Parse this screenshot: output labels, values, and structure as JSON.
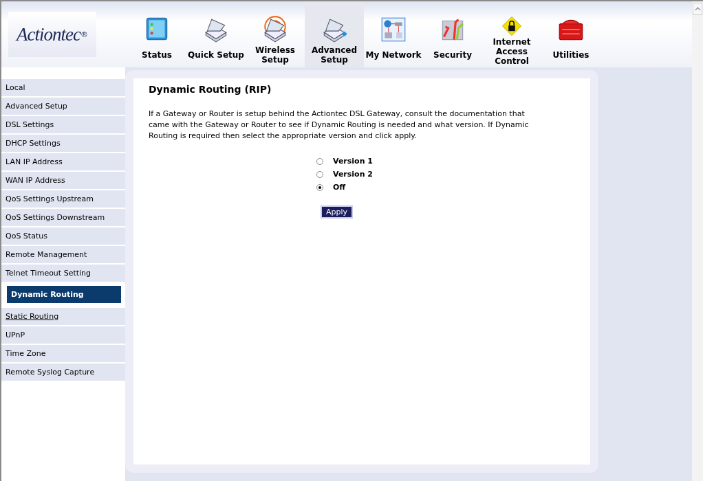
{
  "logo": {
    "text": "Actiontec",
    "mark": "®"
  },
  "nav": [
    {
      "label": "Status",
      "kind": "status",
      "selected": false
    },
    {
      "label": "Quick Setup",
      "kind": "quick",
      "selected": false
    },
    {
      "label": "Wireless Setup",
      "kind": "wireless",
      "selected": false
    },
    {
      "label": "Advanced Setup",
      "kind": "advanced",
      "selected": true
    },
    {
      "label": "My Network",
      "kind": "network",
      "selected": false
    },
    {
      "label": "Security",
      "kind": "security",
      "selected": false
    },
    {
      "label": "Internet Access Control",
      "kind": "lock",
      "selected": false
    },
    {
      "label": "Utilities",
      "kind": "toolbox",
      "selected": false
    }
  ],
  "sidebar": {
    "items": [
      {
        "label": "Local",
        "selected": false,
        "hovered": false
      },
      {
        "label": "Advanced Setup",
        "selected": false,
        "hovered": false
      },
      {
        "label": "DSL Settings",
        "selected": false,
        "hovered": false
      },
      {
        "label": "DHCP Settings",
        "selected": false,
        "hovered": false
      },
      {
        "label": "LAN IP Address",
        "selected": false,
        "hovered": false
      },
      {
        "label": "WAN IP Address",
        "selected": false,
        "hovered": false
      },
      {
        "label": "QoS Settings Upstream",
        "selected": false,
        "hovered": false
      },
      {
        "label": "QoS Settings Downstream",
        "selected": false,
        "hovered": false
      },
      {
        "label": "QoS Status",
        "selected": false,
        "hovered": false
      },
      {
        "label": "Remote Management",
        "selected": false,
        "hovered": false
      },
      {
        "label": "Telnet Timeout Setting",
        "selected": false,
        "hovered": false
      },
      {
        "label": "Dynamic Routing",
        "selected": true,
        "hovered": false
      },
      {
        "label": "Static Routing",
        "selected": false,
        "hovered": true
      },
      {
        "label": "UPnP",
        "selected": false,
        "hovered": false
      },
      {
        "label": "Time Zone",
        "selected": false,
        "hovered": false
      },
      {
        "label": "Remote Syslog Capture",
        "selected": false,
        "hovered": false
      }
    ]
  },
  "content": {
    "title": "Dynamic Routing (RIP)",
    "description": "If a Gateway or Router is setup behind the Actiontec DSL Gateway, consult the documentation that came with the Gateway or Router to see if Dynamic Routing is needed and what version. If Dynamic Routing is required then select the appropriate version and click apply.",
    "options": [
      {
        "label": "Version 1",
        "selected": false
      },
      {
        "label": "Version 2",
        "selected": false
      },
      {
        "label": "Off",
        "selected": true
      }
    ],
    "button": "Apply"
  }
}
